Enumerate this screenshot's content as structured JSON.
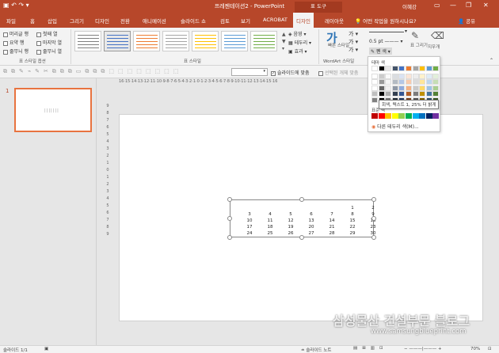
{
  "title_bar": {
    "title": "프레젠테이션2 - PowerPoint",
    "context_tab": "표 도구",
    "user": "이혜강"
  },
  "tabs": [
    "파일",
    "홈",
    "삽입",
    "그리기",
    "디자인",
    "전환",
    "애니메이션",
    "슬라이드 쇼",
    "검토",
    "보기",
    "ACROBAT",
    "디자인",
    "레이아웃"
  ],
  "active_tab_index": 11,
  "tell_me": "어떤 작업을 원하시나요?",
  "share": "공유",
  "style_options": {
    "items": [
      "머리글 행",
      "첫째 열",
      "요약 행",
      "마지막 열",
      "줄무늬 행",
      "줄무늬 열"
    ],
    "label": "표 스타일 옵션"
  },
  "table_styles_label": "표 스타일",
  "style_effects": [
    "음영",
    "테두리",
    "효과"
  ],
  "wordart": {
    "quick_styles": "빠른 스타일",
    "label": "WordArt 스타일"
  },
  "borders": {
    "pen_weight": "0.5 pt",
    "pen_color": "펜 색",
    "draw_table": "표 그리기",
    "eraser": "지우개"
  },
  "toolbar2": {
    "select": "슬라이드에 맞춤",
    "select_checked": true,
    "linked": "선택된 개체 맞춤"
  },
  "ruler_text": "16·15·14·13·12·11·10·9·8·7·6·5·4·3·2·1·0·1·2·3·4·5·6·7·8·9·10·11·12·13·14·15·16",
  "color_dropdown": {
    "theme_title": "테마 색",
    "standard_title": "표준 색",
    "tooltip": "회색, 텍스트 1, 25% 더 밝게",
    "more_colors": "다른 테두리 색(M)...",
    "theme_top": [
      "#ffffff",
      "#000000",
      "#e7e6e6",
      "#44546a",
      "#4472c4",
      "#ed7d31",
      "#a5a5a5",
      "#ffc000",
      "#5b9bd5",
      "#70ad47"
    ],
    "standard": [
      "#c00000",
      "#ff0000",
      "#ffc000",
      "#ffff00",
      "#92d050",
      "#00b050",
      "#00b0f0",
      "#0070c0",
      "#002060",
      "#7030a0"
    ]
  },
  "slide_number": "1",
  "calendar": {
    "rows": [
      [
        "",
        "",
        "",
        "",
        "",
        "1",
        "2"
      ],
      [
        "3",
        "4",
        "5",
        "6",
        "7",
        "8",
        "9"
      ],
      [
        "10",
        "11",
        "12",
        "13",
        "14",
        "15",
        "16"
      ],
      [
        "17",
        "18",
        "19",
        "20",
        "21",
        "22",
        "23"
      ],
      [
        "24",
        "25",
        "26",
        "27",
        "28",
        "29",
        "30"
      ]
    ]
  },
  "status": {
    "slide": "슬라이드 1/1",
    "notes": "슬라이드 노트",
    "zoom": "70%"
  },
  "watermark": {
    "line1": "삼성물산 건설부문 블로그",
    "line2": "www.samsungblueprint.com"
  },
  "colors": {
    "accent": "#b7472a",
    "selection": "#e8733f"
  }
}
